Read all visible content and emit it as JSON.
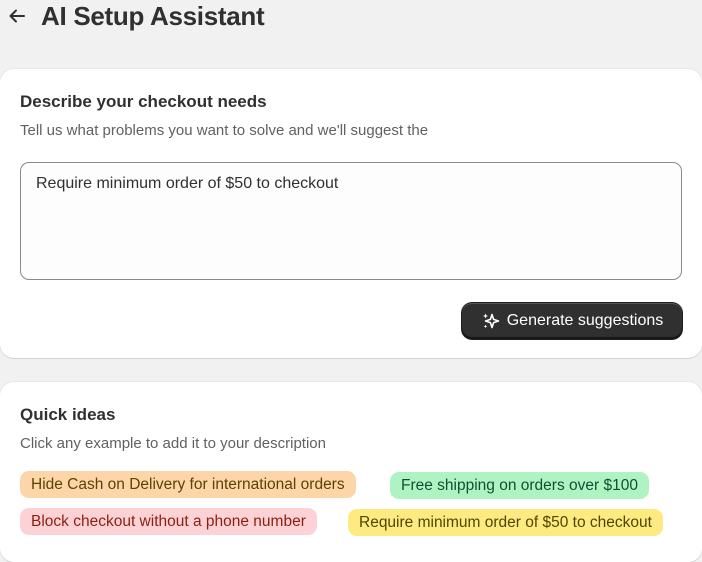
{
  "header": {
    "title": "AI Setup Assistant",
    "back_icon": "arrow-left-icon"
  },
  "describe": {
    "title": "Describe your checkout needs",
    "subtitle": "Tell us what problems you want to solve and we'll suggest the",
    "input_value": "Require minimum order of $50 to checkout",
    "generate_label": "Generate suggestions",
    "generate_icon": "sparkle-icon"
  },
  "quick": {
    "title": "Quick ideas",
    "subtitle": "Click any example to add it to your description",
    "chips": [
      {
        "label": "Hide Cash on Delivery for international orders",
        "bg": "#fcd6a8",
        "fg": "#5e4200"
      },
      {
        "label": "Free shipping on orders over $100",
        "bg": "#aff3c2",
        "fg": "#0c5132"
      },
      {
        "label": "Block checkout without a phone number",
        "bg": "#fdd2d6",
        "fg": "#8e1f0b"
      },
      {
        "label": "Require minimum order of $50 to checkout",
        "bg": "#fdeb82",
        "fg": "#4f4700"
      }
    ]
  }
}
